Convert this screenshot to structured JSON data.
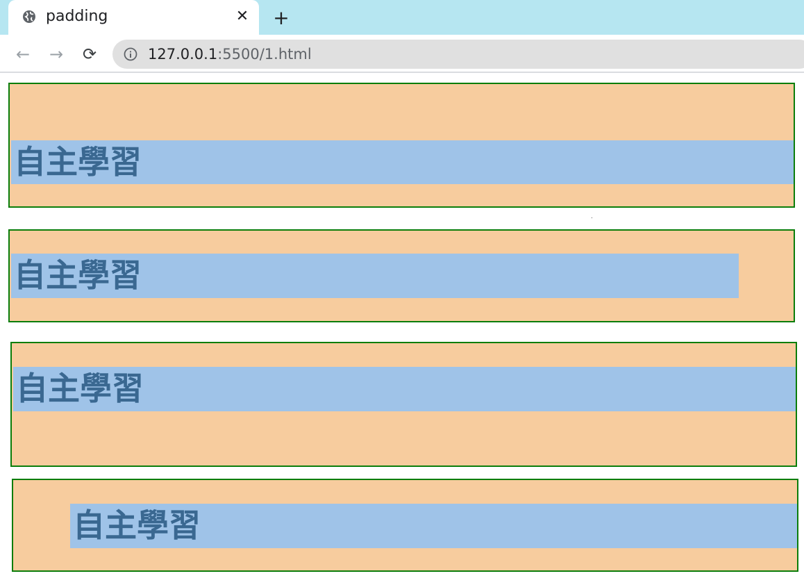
{
  "browser": {
    "tab": {
      "title": "padding",
      "close_glyph": "✕",
      "icon": "globe-icon"
    },
    "new_tab_glyph": "+",
    "nav": {
      "back_glyph": "←",
      "forward_glyph": "→",
      "reload_glyph": "⟳"
    },
    "address": {
      "host": "127.0.0.1",
      "path": ":5500/1.html",
      "icon": "info-icon"
    }
  },
  "content": {
    "boxes": [
      {
        "text": "自主學習"
      },
      {
        "text": "自主學習"
      },
      {
        "text": "自主學習"
      },
      {
        "text": "自主學習"
      }
    ]
  },
  "colors": {
    "tabstrip": "#b6e6f1",
    "outer_bg": "#f7cc9e",
    "outer_border": "#0a7d0a",
    "inner_bg": "#9fc3e8",
    "inner_text": "#3a6891"
  }
}
